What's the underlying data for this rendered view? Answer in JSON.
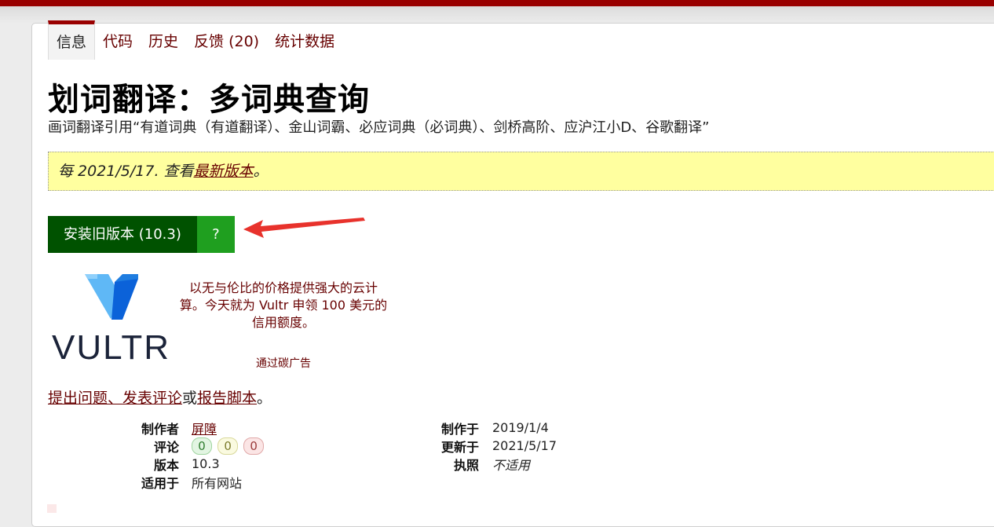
{
  "tabs": [
    {
      "label": "信息"
    },
    {
      "label": "代码"
    },
    {
      "label": "历史"
    },
    {
      "label": "反馈 (20)"
    },
    {
      "label": "统计数据"
    }
  ],
  "script": {
    "title": "划词翻译：多词典查询",
    "description": "画词翻译引用“有道词典（有道翻译）、金山词霸、必应词典（必词典）、剑桥高阶、应沪江小D、谷歌翻译”"
  },
  "notice": {
    "prefix": "每 2021/5/17. 查看",
    "link": "最新版本",
    "suffix": "。"
  },
  "install": {
    "button_label": "安装旧版本 (10.3)",
    "help_label": "?"
  },
  "ad": {
    "logo_text": "VULTR",
    "text": "以无与伦比的价格提供强大的云计算。今天就为 Vultr 申领 100 美元的信用额度。",
    "via": "通过碳广告"
  },
  "feedback": {
    "link1": "提出问题、发表评论",
    "mid": "或",
    "link2": "报告脚本",
    "end": "。"
  },
  "meta": {
    "author_label": "制作者",
    "author": "屏障",
    "ratings_label": "评论",
    "ratings": {
      "good": "0",
      "ok": "0",
      "bad": "0"
    },
    "version_label": "版本",
    "version": "10.3",
    "applies_label": "适用于",
    "applies": "所有网站",
    "created_label": "制作于",
    "created": "2019/1/4",
    "updated_label": "更新于",
    "updated": "2021/5/17",
    "license_label": "执照",
    "license": "不适用"
  },
  "colors": {
    "brand": "#990000",
    "link": "#670000",
    "install": "#005200",
    "help": "#1f9f1f",
    "notice_bg": "#ffff9f",
    "arrow": "#e8322c"
  }
}
